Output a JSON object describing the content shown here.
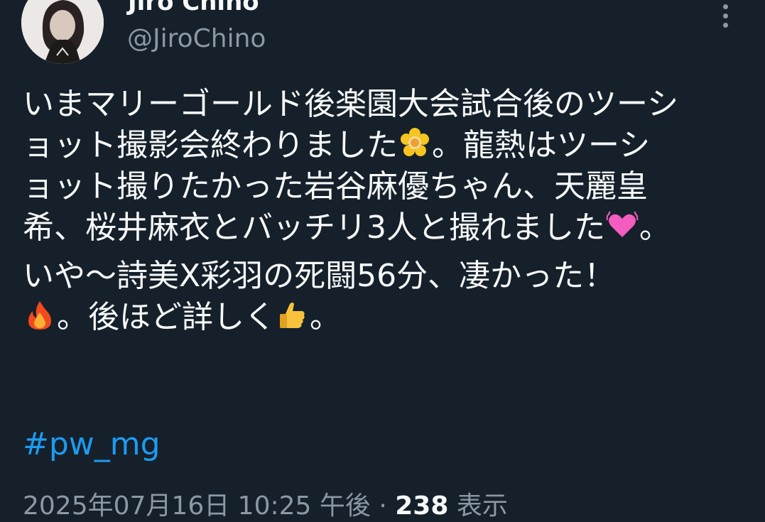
{
  "author": {
    "display_name": "Jiro Chino",
    "handle": "@JiroChino",
    "avatar_icon": "profile-photo"
  },
  "more_icon": "more-vertical-icon",
  "tweet": {
    "lines": [
      {
        "text": "いまマリーゴールド後楽園大会試合後のツーシ"
      },
      {
        "text": "ョット撮影会終わりました",
        "emoji": "blossom-emoji",
        "after": "。龍熱はツーシ"
      },
      {
        "text": "ョット撮りたかった岩谷麻優ちゃん、天麗皇"
      },
      {
        "text": "希、桜井麻衣とバッチリ3人と撮れました",
        "emoji": "beating-heart-emoji",
        "after": "。"
      },
      {
        "text": "いや〜詩美X彩羽の死闘56分、凄かった！"
      },
      {
        "text": "",
        "emoji": "fire-emoji",
        "after": "。後ほど詳しく"
      },
      {
        "text": "",
        "emoji": "thumbs-up-emoji",
        "after": "。"
      }
    ],
    "hashtag": "#pw_mg"
  },
  "meta": {
    "timestamp": "2025年07月16日 10:25 午後",
    "separator": " · ",
    "views_count": "238",
    "views_label": " 表示"
  },
  "colors": {
    "background": "#15202b",
    "text": "#f7f9f9",
    "secondary": "#8b98a5",
    "accent": "#1d9bf0"
  }
}
